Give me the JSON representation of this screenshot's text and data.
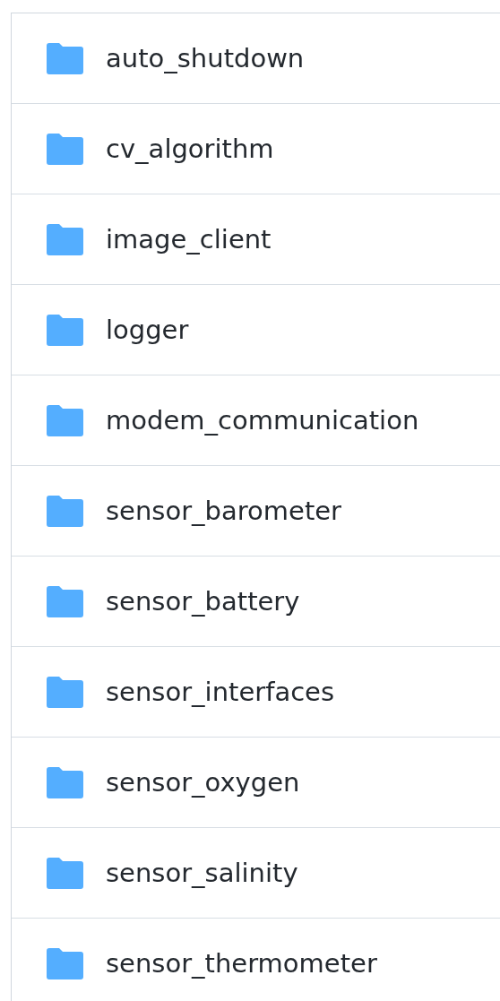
{
  "folders": [
    {
      "name": "auto_shutdown"
    },
    {
      "name": "cv_algorithm"
    },
    {
      "name": "image_client"
    },
    {
      "name": "logger"
    },
    {
      "name": "modem_communication"
    },
    {
      "name": "sensor_barometer"
    },
    {
      "name": "sensor_battery"
    },
    {
      "name": "sensor_interfaces"
    },
    {
      "name": "sensor_oxygen"
    },
    {
      "name": "sensor_salinity"
    },
    {
      "name": "sensor_thermometer"
    }
  ]
}
